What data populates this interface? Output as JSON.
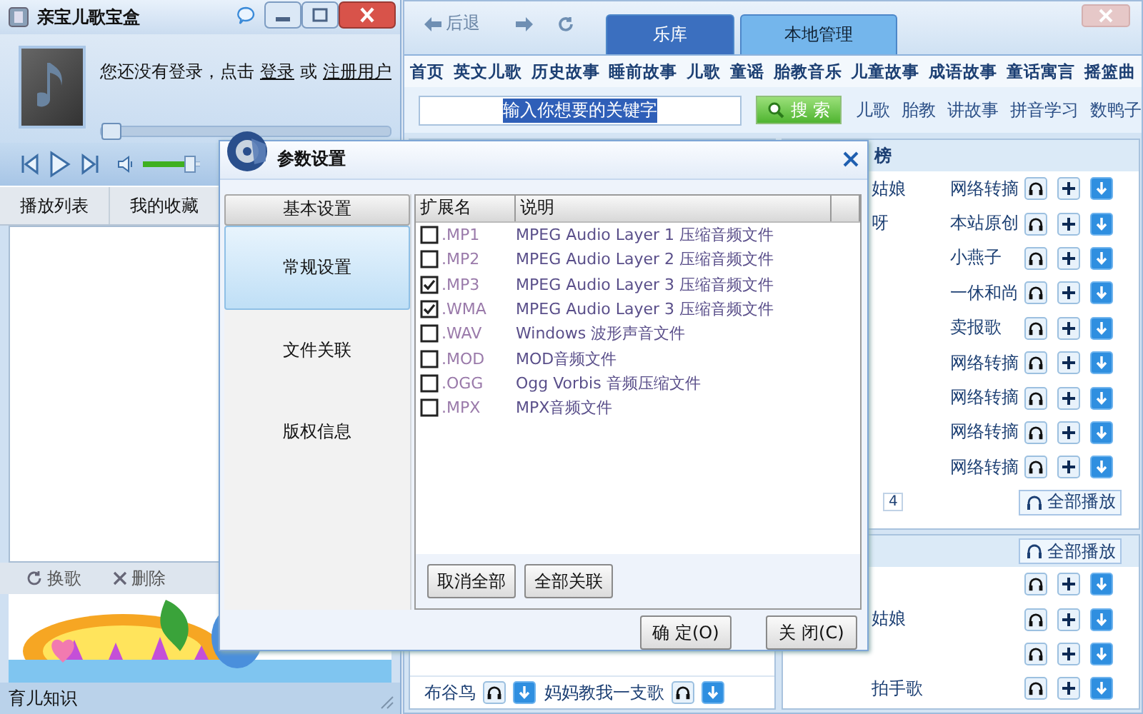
{
  "player": {
    "title": "亲宝儿歌宝盒",
    "login_prompt": "您还没有登录，点击",
    "login_link": "登录",
    "login_or": "或",
    "register_link": "注册用户",
    "progress": {
      "level": 0
    },
    "volume": {
      "level": 0.9
    },
    "tabs": [
      "播放列表",
      "我的收藏"
    ],
    "actions": [
      "换歌",
      "删除"
    ],
    "banner": {
      "kind": "picture"
    },
    "status": "育儿知识"
  },
  "library": {
    "back": "后退",
    "tabs": [
      {
        "label": "乐库",
        "selected": true
      },
      {
        "label": "本地管理",
        "selected": false
      }
    ],
    "categories": [
      "首页",
      "英文儿歌",
      "历史故事",
      "睡前故事",
      "儿歌",
      "童谣",
      "胎教音乐",
      "儿童故事",
      "成语故事",
      "童话寓言",
      "摇篮曲"
    ],
    "search": {
      "value": "输入你想要的关键字"
    },
    "search_button": "搜 索",
    "quick_links": [
      "儿歌",
      "胎教",
      "讲故事",
      "拼音学习",
      "数鸭子"
    ],
    "chart_panel": {
      "title": "榜",
      "rows": [
        {
          "title": "姑娘",
          "source": "网络转摘"
        },
        {
          "title": "呀",
          "source": "本站原创"
        },
        {
          "source": "小燕子"
        },
        {
          "source": "一休和尚"
        },
        {
          "source": "卖报歌"
        },
        {
          "source": "网络转摘"
        },
        {
          "source": "网络转摘"
        },
        {
          "source": "网络转摘"
        },
        {
          "source": "网络转摘"
        }
      ],
      "page": "4",
      "play_all": "全部播放"
    },
    "second_panel": {
      "play_all": "全部播放",
      "rows": [
        {},
        {
          "title": "姑娘"
        },
        {},
        {
          "title": "拍手歌"
        }
      ]
    },
    "bottom_row": [
      {
        "title": "布谷鸟"
      },
      {
        "title": "妈妈教我一支歌"
      }
    ]
  },
  "dialog": {
    "title": "参数设置",
    "nav_header": "基本设置",
    "nav": [
      {
        "label": "常规设置",
        "selected": true
      },
      {
        "label": "文件关联",
        "selected": false
      },
      {
        "label": "版权信息",
        "selected": false
      }
    ],
    "columns": [
      "扩展名",
      "说明"
    ],
    "rows": [
      {
        "ext": ".MP1",
        "desc": "MPEG Audio Layer 1 压缩音频文件",
        "checked": false
      },
      {
        "ext": ".MP2",
        "desc": "MPEG Audio Layer 2 压缩音频文件",
        "checked": false
      },
      {
        "ext": ".MP3",
        "desc": "MPEG Audio Layer 3 压缩音频文件",
        "checked": true
      },
      {
        "ext": ".WMA",
        "desc": "MPEG Audio Layer 3 压缩音频文件",
        "checked": true
      },
      {
        "ext": ".WAV",
        "desc": "Windows 波形声音文件",
        "checked": false
      },
      {
        "ext": ".MOD",
        "desc": "MOD音频文件",
        "checked": false
      },
      {
        "ext": ".OGG",
        "desc": "Ogg Vorbis 音频压缩文件",
        "checked": false
      },
      {
        "ext": ".MPX",
        "desc": "MPX音频文件",
        "checked": false
      }
    ],
    "buttons": [
      "取消全部",
      "全部关联"
    ],
    "footer": [
      "确 定(O)",
      "关 闭(C)"
    ]
  }
}
